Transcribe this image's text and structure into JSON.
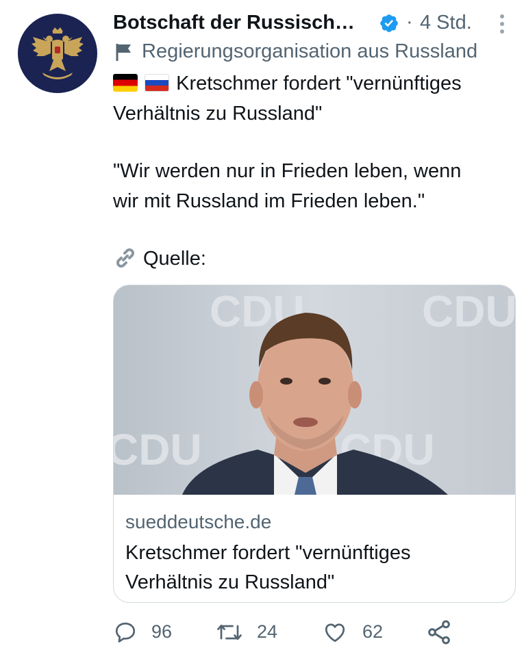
{
  "tweet": {
    "author_name": "Botschaft der Russisch…",
    "separator": "·",
    "time": "4 Std.",
    "label": "Regierungsorganisation aus Russland",
    "text_line1": "Kretschmer fordert \"vernünftiges",
    "text_line2": "Verhältnis zu Russland\"",
    "quote_line1": "\"Wir werden nur in Frieden leben, wenn",
    "quote_line2": "wir mit Russland im Frieden leben.\"",
    "source_label": "Quelle:",
    "flags": [
      "flag-germany-icon",
      "flag-russia-icon"
    ]
  },
  "card": {
    "domain": "sueddeutsche.de",
    "title_line1": "Kretschmer fordert \"vernünftiges",
    "title_line2": "Verhältnis zu Russland\"",
    "image_backdrop_text": "CDU"
  },
  "actions": {
    "replies": "96",
    "retweets": "24",
    "likes": "62"
  },
  "colors": {
    "text": "#0f1419",
    "secondary": "#536471",
    "verified": "#1d9bf0",
    "border": "#cfd9de",
    "avatar_bg": "#1a2352",
    "emblem": "#c9a55a"
  }
}
